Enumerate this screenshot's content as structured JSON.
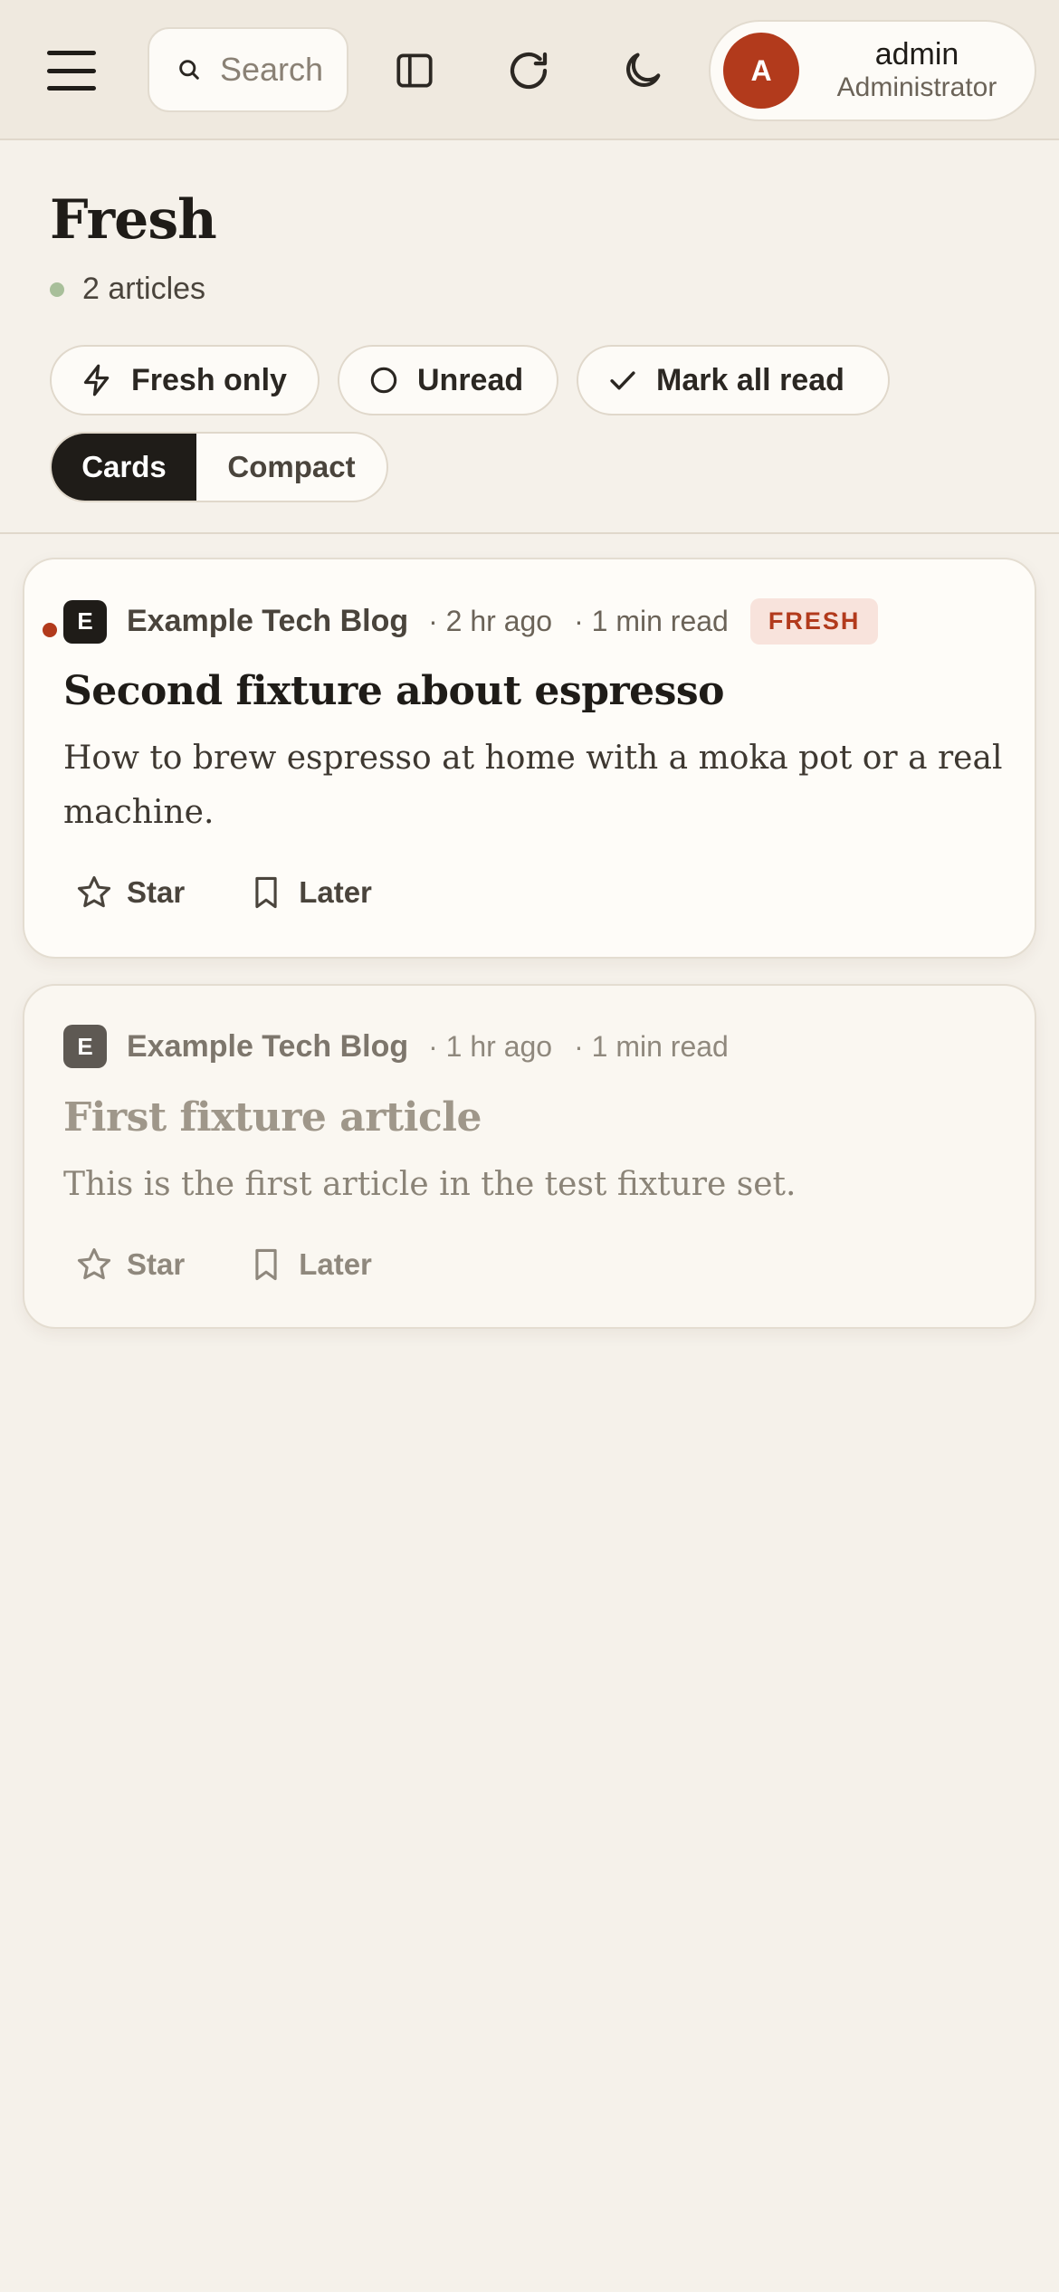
{
  "header": {
    "search_placeholder": "Search",
    "user": {
      "initial": "A",
      "name": "admin",
      "role": "Administrator"
    },
    "icons": [
      "menu-icon",
      "search-icon",
      "sidebar-icon",
      "refresh-icon",
      "moon-icon"
    ]
  },
  "page": {
    "title": "Fresh",
    "article_count": "2 articles"
  },
  "filters": {
    "fresh_only": "Fresh only",
    "unread": "Unread",
    "mark_all_read": "Mark all read"
  },
  "view_toggle": {
    "cards": "Cards",
    "compact": "Compact",
    "selected": "Cards"
  },
  "articles": [
    {
      "feed_initial": "E",
      "feed_name": "Example Tech Blog",
      "age": "· 2 hr ago",
      "read_time": "· 1 min read",
      "badge": "FRESH",
      "title": "Second fixture about espresso",
      "summary": "How to brew espresso at home with a moka pot or a real machine.",
      "star_label": "Star",
      "later_label": "Later",
      "unread": true
    },
    {
      "feed_initial": "E",
      "feed_name": "Example Tech Blog",
      "age": "· 1 hr ago",
      "read_time": "· 1 min read",
      "title": "First fixture article",
      "summary": "This is the first article in the test fixture set.",
      "star_label": "Star",
      "later_label": "Later",
      "unread": false
    }
  ],
  "colors": {
    "background": "#f5f1ea",
    "topbar": "#efe9df",
    "accent": "#b23a1c",
    "fresh_badge_bg": "#f8e3dc",
    "status_dot": "#a8bf9a",
    "active_toggle": "#1f1c18"
  }
}
